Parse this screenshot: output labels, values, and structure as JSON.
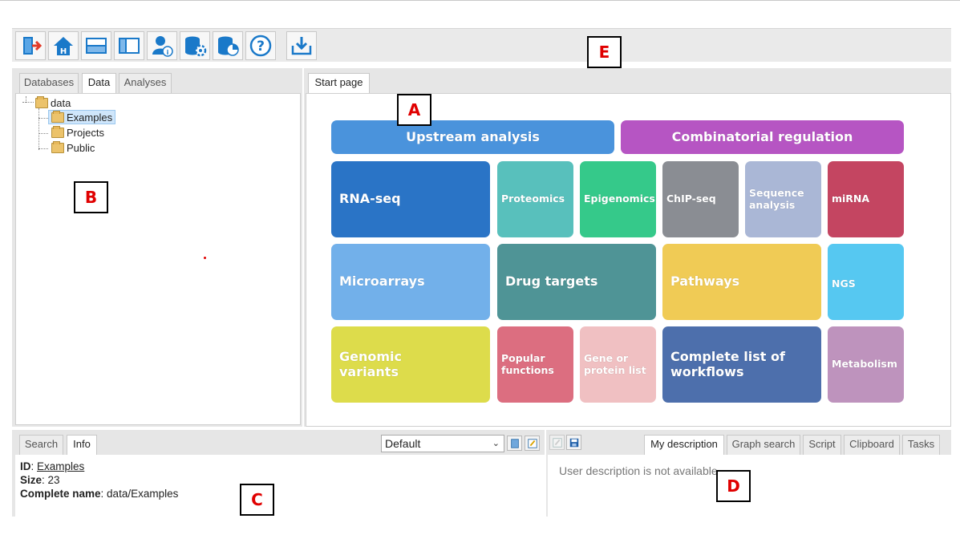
{
  "toolbar": {
    "buttons": [
      {
        "name": "exit-icon",
        "color": "#1a79c9"
      },
      {
        "name": "home-icon",
        "color": "#1a79c9"
      },
      {
        "name": "horizontal-layout-icon",
        "color": "#1a79c9"
      },
      {
        "name": "vertical-layout-icon",
        "color": "#1a79c9"
      },
      {
        "name": "user-info-icon",
        "color": "#1a79c9"
      },
      {
        "name": "database-settings-icon",
        "color": "#1a79c9"
      },
      {
        "name": "database-chart-icon",
        "color": "#1a79c9"
      },
      {
        "name": "help-icon",
        "color": "#1a79c9"
      },
      {
        "name": "download-icon",
        "color": "#1a79c9"
      }
    ]
  },
  "left_panel": {
    "tabs": [
      "Databases",
      "Data",
      "Analyses"
    ],
    "active_tab": "Data",
    "tree": {
      "root": "data",
      "children": [
        "Examples",
        "Projects",
        "Public"
      ],
      "selected": "Examples"
    }
  },
  "main_panel": {
    "tab": "Start page",
    "headers": [
      {
        "label": "Upstream analysis",
        "color": "#4a93dc"
      },
      {
        "label": "Combinatorial regulation",
        "color": "#b655c3"
      }
    ],
    "tiles": [
      {
        "label": "RNA-seq",
        "color": "#2a74c6"
      },
      {
        "label": "Proteomics",
        "color": "#58c0bc"
      },
      {
        "label": "Epigenomics",
        "color": "#35c98a"
      },
      {
        "label": "ChIP-seq",
        "color": "#8a8d93"
      },
      {
        "label": "Sequence analysis",
        "color": "#aab7d6"
      },
      {
        "label": "miRNA",
        "color": "#c44561"
      },
      {
        "label": "Microarrays",
        "color": "#72b0ea"
      },
      {
        "label": "Drug targets",
        "color": "#4f9496"
      },
      {
        "label": "Pathways",
        "color": "#f0cb55"
      },
      {
        "label": "NGS",
        "color": "#56c8f1"
      },
      {
        "label": "Genomic variants",
        "color": "#dddc4b"
      },
      {
        "label": "Popular functions",
        "color": "#dc6e80"
      },
      {
        "label": "Gene or protein list",
        "color": "#f0c0c2"
      },
      {
        "label": "Complete list of workflows",
        "color": "#4d6fac"
      },
      {
        "label": "Metabolism",
        "color": "#be93bd"
      }
    ]
  },
  "info_panel": {
    "tabs": [
      "Search",
      "Info"
    ],
    "active_tab": "Info",
    "view_select": "Default",
    "fields": [
      {
        "key": "ID",
        "value": "Examples"
      },
      {
        "key": "Size",
        "value": "23"
      },
      {
        "key": "Complete name",
        "value": "data/Examples"
      }
    ]
  },
  "description_panel": {
    "tabs": [
      "My description",
      "Graph search",
      "Script",
      "Clipboard",
      "Tasks"
    ],
    "active_tab": "My description",
    "text": "User description is not available"
  },
  "markers": {
    "A": "A",
    "B": "B",
    "C": "C",
    "D": "D",
    "E": "E"
  }
}
